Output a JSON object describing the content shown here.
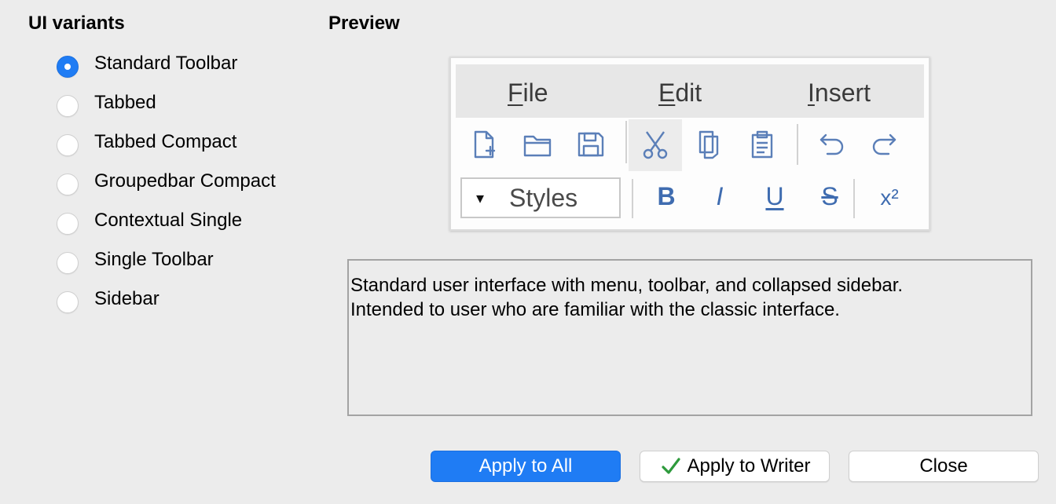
{
  "variants": {
    "title": "UI variants",
    "items": [
      {
        "label": "Standard Toolbar",
        "checked": true
      },
      {
        "label": "Tabbed",
        "checked": false
      },
      {
        "label": "Tabbed Compact",
        "checked": false
      },
      {
        "label": "Groupedbar Compact",
        "checked": false
      },
      {
        "label": "Contextual Single",
        "checked": false
      },
      {
        "label": "Single Toolbar",
        "checked": false
      },
      {
        "label": "Sidebar",
        "checked": false
      }
    ]
  },
  "preview": {
    "title": "Preview",
    "menu": {
      "file": {
        "first": "F",
        "rest": "ile"
      },
      "edit": {
        "first": "E",
        "rest": "dit"
      },
      "insert": {
        "first": "I",
        "rest": "nsert"
      }
    },
    "toolbar_icons": [
      "new-document-icon",
      "open-folder-icon",
      "save-icon",
      "cut-icon",
      "copy-icon",
      "paste-icon",
      "undo-icon",
      "redo-icon"
    ],
    "styles": {
      "arrow": "▾",
      "label": "Styles"
    },
    "format": {
      "bold": "B",
      "italic": "I",
      "underline": "U",
      "strike": "S",
      "superscript": "x²"
    }
  },
  "description": {
    "line1": "Standard user interface with menu, toolbar, and collapsed sidebar.",
    "line2": "Intended to user who are familiar with the classic interface."
  },
  "buttons": {
    "apply_all": "Apply to All",
    "apply_writer": "Apply to Writer",
    "close": "Close"
  },
  "colors": {
    "accent": "#1f7cf4",
    "icon_stroke": "#5b7fb8",
    "check_green": "#2e9a3c"
  }
}
